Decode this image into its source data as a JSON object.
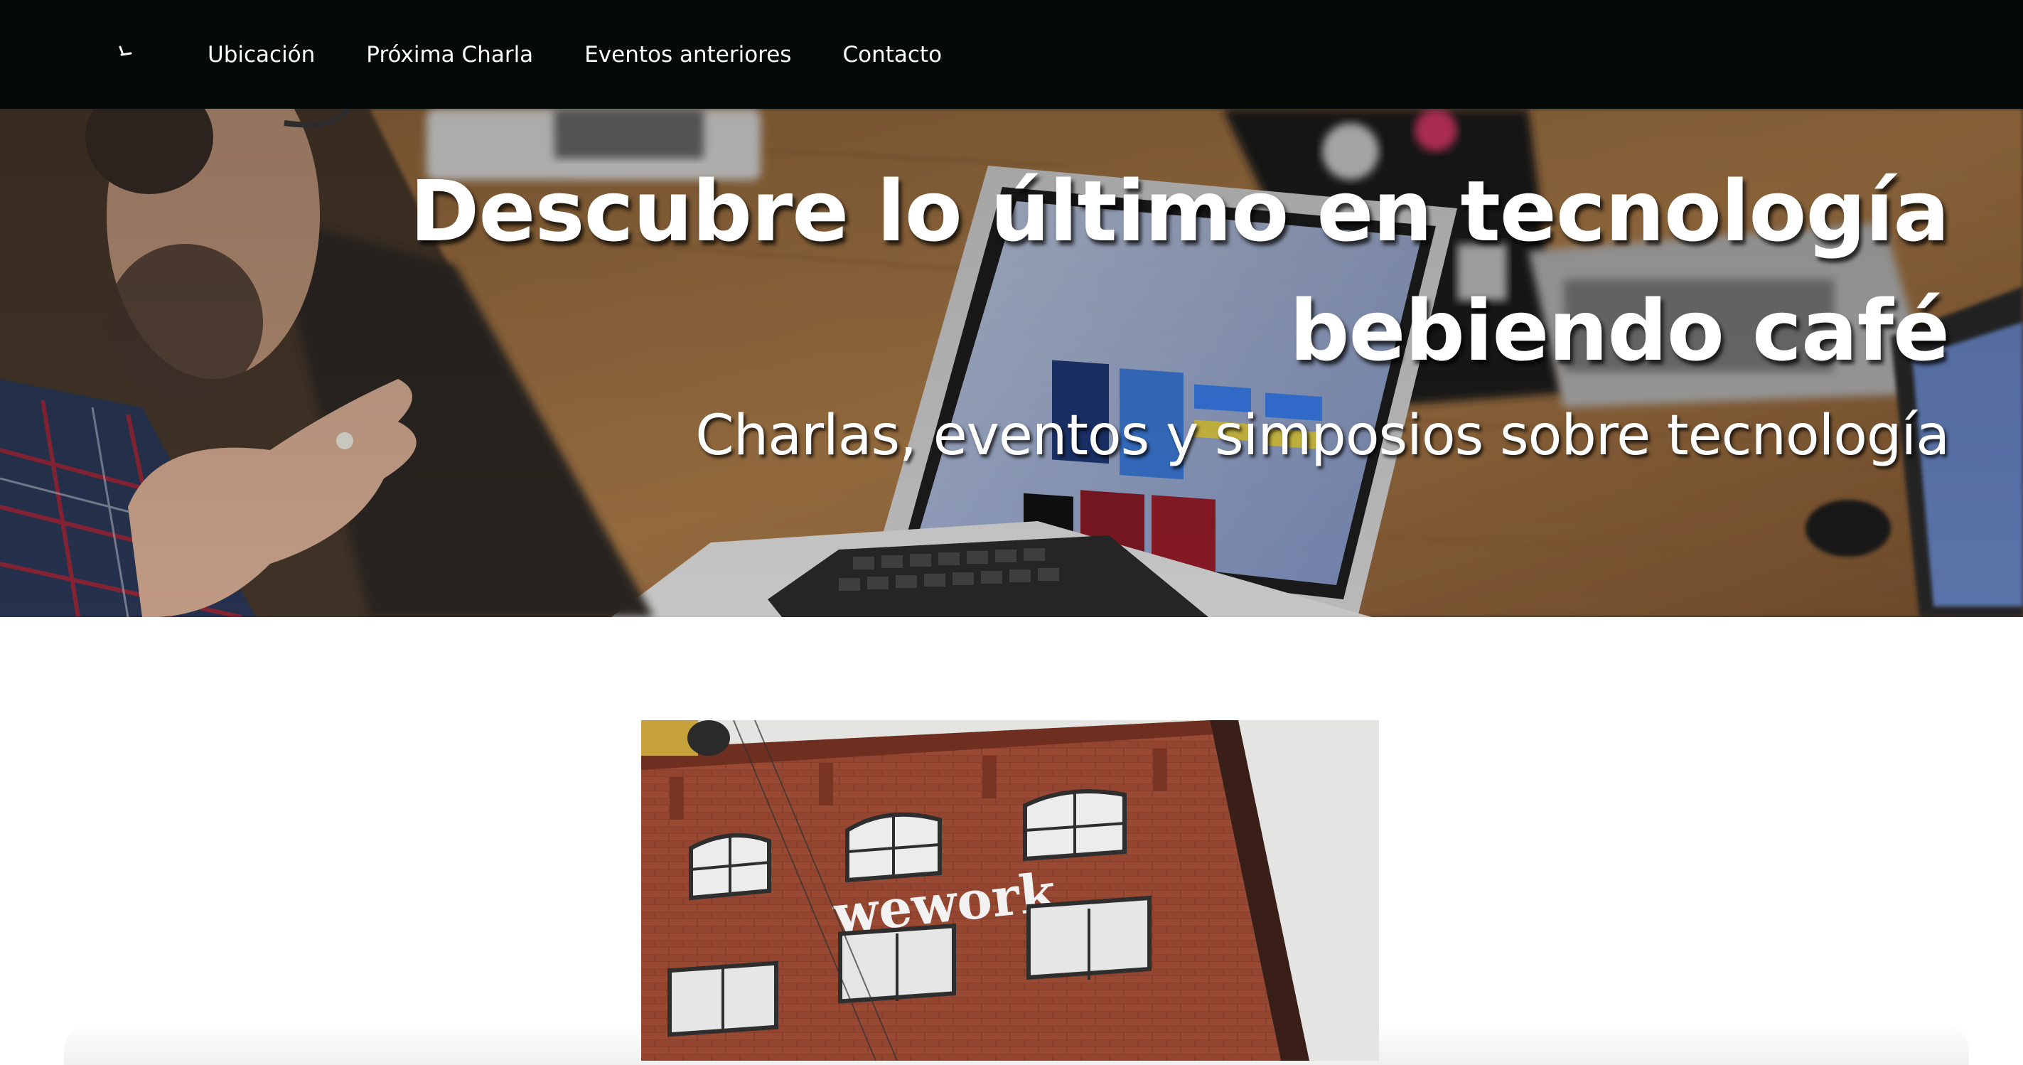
{
  "nav": {
    "logo_icon": "coffee-cup-logo-icon",
    "items": [
      {
        "label": "Ubicación"
      },
      {
        "label": "Próxima Charla"
      },
      {
        "label": "Eventos anteriores"
      },
      {
        "label": "Contacto"
      }
    ]
  },
  "hero": {
    "title": "Descubre lo último en tecnología bebiendo café",
    "subtitle": "Charlas, eventos y simposios sobre tecnología"
  },
  "venue": {
    "sign_text": "wework"
  },
  "colors": {
    "navbar": "#030a07",
    "hero_text": "#ffffff",
    "brick": "#8a3f2c"
  }
}
